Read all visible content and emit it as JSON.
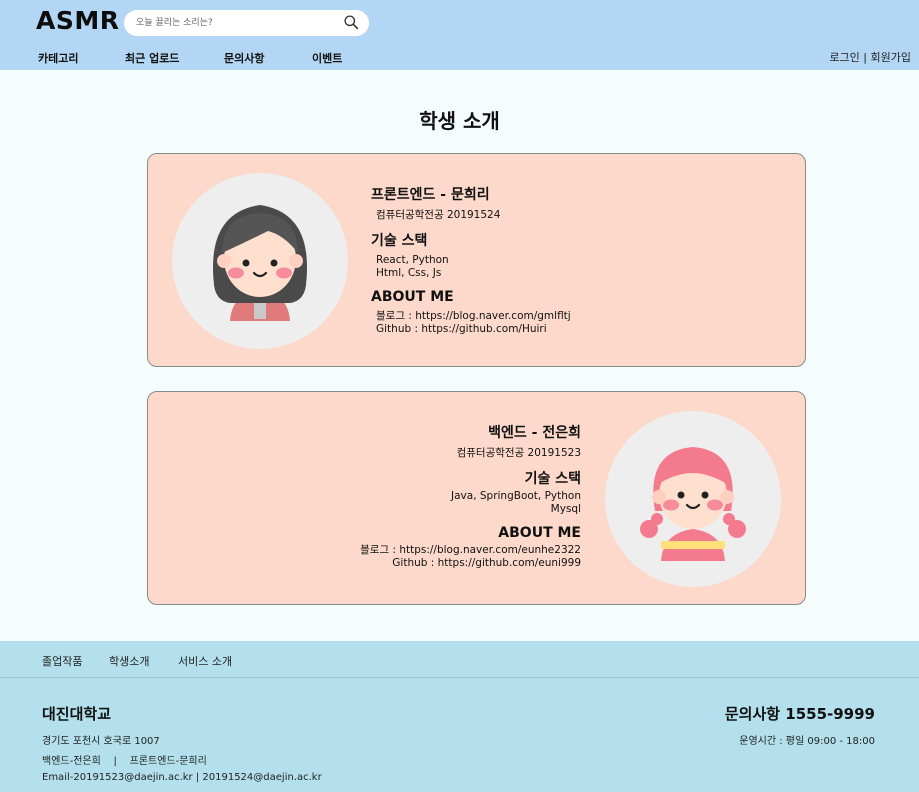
{
  "header": {
    "logo": "ASMR",
    "search_placeholder": "오늘 끌리는 소리는?",
    "nav": [
      "카테고리",
      "최근 업로드",
      "문의사항",
      "이벤트"
    ],
    "login": "로그인",
    "separator": " | ",
    "signup": "회원가입"
  },
  "page": {
    "title": "학생 소개"
  },
  "cards": [
    {
      "role": "프론트엔드 - 문희리",
      "major": "컴퓨터공학전공 20191524",
      "stack_heading": "기술 스택",
      "stack": [
        "React, Python",
        "Html, Css, Js"
      ],
      "about_heading": "ABOUT ME",
      "about": [
        "블로그 : https://blog.naver.com/gmlfltj",
        "Github : https://github.com/Huiri"
      ]
    },
    {
      "role": "백엔드 - 전은희",
      "major": "컴퓨터공학전공 20191523",
      "stack_heading": "기술 스택",
      "stack": [
        "Java, SpringBoot, Python",
        "Mysql"
      ],
      "about_heading": "ABOUT ME",
      "about": [
        "블로그 : https://blog.naver.com/eunhe2322",
        "Github : https://github.com/euni999"
      ]
    }
  ],
  "footer": {
    "links": [
      "졸업작품",
      "학생소개",
      "서비스 소개"
    ],
    "university": "대진대학교",
    "address": "경기도 포천시 호국로 1007",
    "members": "백엔드-전은희    |    프론트엔드-문희리",
    "email": "Email-20191523@daejin.ac.kr | 20191524@daejin.ac.kr",
    "contact": "문의사항 1555-9999",
    "hours": "운영시간 : 평일 09:00 - 18:00"
  },
  "colors": {
    "header_bg": "#b3d6f5",
    "page_bg": "#f4fcfc",
    "card_bg": "#fdd9cc",
    "footer_bg": "#b3e0ec"
  }
}
